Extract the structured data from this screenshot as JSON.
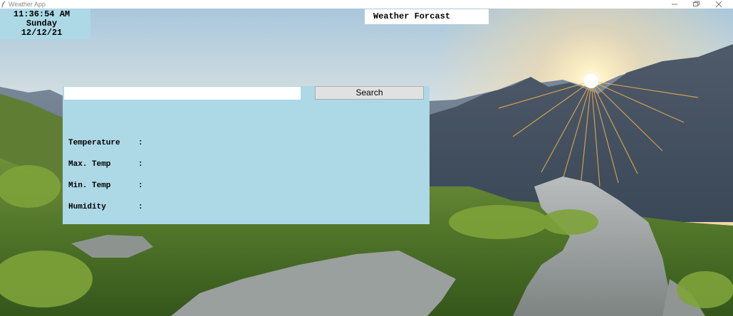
{
  "window": {
    "title": "Weather App",
    "app_icon": "feather-icon",
    "controls": [
      "minimize-icon",
      "restore-icon",
      "close-icon"
    ]
  },
  "clock": {
    "time": "11:36:54 AM",
    "day": "Sunday",
    "date": "12/12/21"
  },
  "heading": {
    "title": "Weather Forcast"
  },
  "search": {
    "value": "",
    "button_label": "Search"
  },
  "weather": {
    "temperature": {
      "label": "Temperature",
      "separator": ":",
      "value": ""
    },
    "max_temp": {
      "label": "Max. Temp",
      "separator": ":",
      "value": ""
    },
    "min_temp": {
      "label": "Min. Temp",
      "separator": ":",
      "value": ""
    },
    "humidity": {
      "label": "Humidity",
      "separator": ":",
      "value": ""
    }
  },
  "colors": {
    "panel": "#add8e6",
    "heading_bg": "#ffffff",
    "button_bg": "#e1e1e1"
  }
}
